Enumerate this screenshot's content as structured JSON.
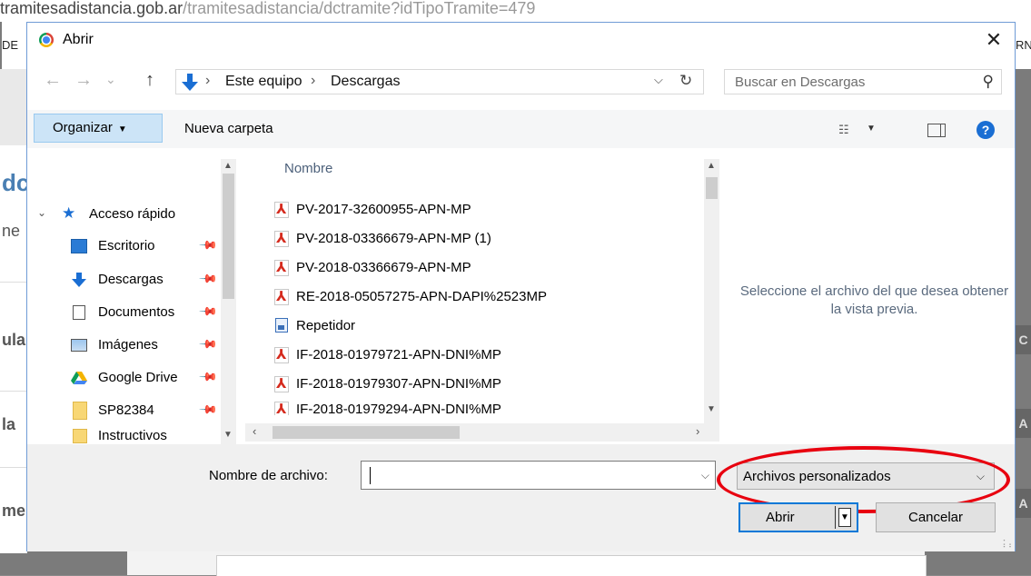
{
  "background": {
    "url_text": "tramitesadistancia.gob.ar",
    "url_path": "/tramitesadistancia/dctramite?idTipoTramite=479",
    "tab_left": "DE",
    "tab_right": "RN",
    "left_fragments": [
      "dc",
      "ne",
      "ula",
      "la",
      "me"
    ],
    "right_fragments": [
      "C",
      "A",
      "A"
    ]
  },
  "dialog": {
    "title": "Abrir",
    "close_label": "✕",
    "nav": {
      "back": "←",
      "forward": "→",
      "recent": "⌄",
      "up": "↑",
      "breadcrumbs": [
        "Este equipo",
        "Descargas"
      ],
      "separator": "›",
      "search_placeholder": "Buscar en Descargas"
    },
    "toolbar": {
      "organize_label": "Organizar",
      "new_folder_label": "Nueva carpeta",
      "help_label": "?"
    },
    "nav_pane": {
      "quick_access": "Acceso rápido",
      "items": [
        {
          "label": "Escritorio",
          "icon": "desktop-icon",
          "pinned": true
        },
        {
          "label": "Descargas",
          "icon": "download-icon",
          "pinned": true
        },
        {
          "label": "Documentos",
          "icon": "documents-icon",
          "pinned": true
        },
        {
          "label": "Imágenes",
          "icon": "pictures-icon",
          "pinned": true
        },
        {
          "label": "Google Drive",
          "icon": "google-drive-icon",
          "pinned": true
        },
        {
          "label": "SP82384",
          "icon": "folder-icon",
          "pinned": true
        },
        {
          "label": "Instructivos",
          "icon": "folder-icon",
          "pinned": false
        }
      ]
    },
    "file_list": {
      "column_header": "Nombre",
      "files": [
        {
          "name": "PV-2017-32600955-APN-MP",
          "type": "pdf"
        },
        {
          "name": "PV-2018-03366679-APN-MP (1)",
          "type": "pdf"
        },
        {
          "name": "PV-2018-03366679-APN-MP",
          "type": "pdf"
        },
        {
          "name": "RE-2018-05057275-APN-DAPI%2523MP",
          "type": "pdf"
        },
        {
          "name": "Repetidor",
          "type": "image"
        },
        {
          "name": "IF-2018-01979721-APN-DNI%MP",
          "type": "pdf"
        },
        {
          "name": "IF-2018-01979307-APN-DNI%MP",
          "type": "pdf"
        },
        {
          "name": "IF-2018-01979294-APN-DNI%MP",
          "type": "pdf"
        }
      ]
    },
    "preview_text": "Seleccione el archivo del que desea obtener la vista previa.",
    "bottom": {
      "file_name_label": "Nombre de archivo:",
      "file_name_value": "",
      "filter_value": "Archivos personalizados",
      "open_label": "Abrir",
      "cancel_label": "Cancelar"
    },
    "colors": {
      "accent": "#0078d7",
      "highlight_ellipse": "#e8000f",
      "organize_bg": "#cce4f7"
    }
  }
}
